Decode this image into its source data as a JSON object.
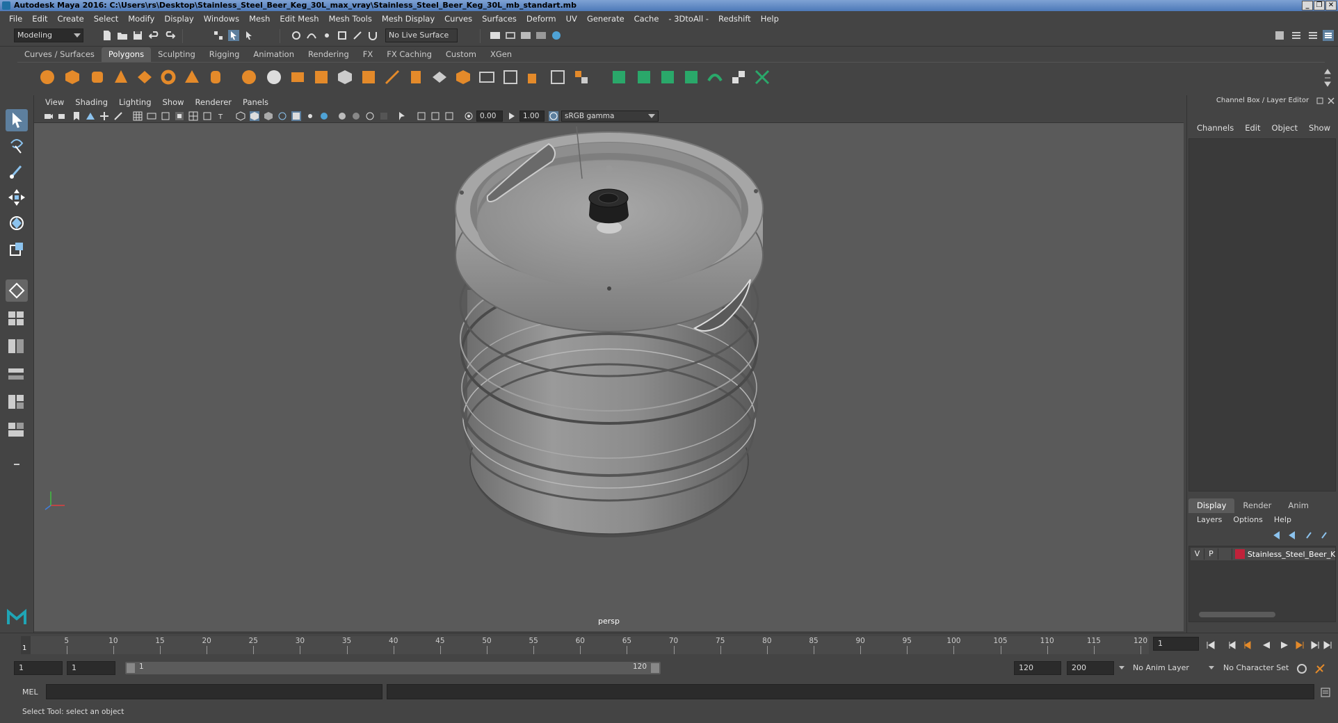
{
  "window": {
    "title": "Autodesk Maya 2016: C:\\Users\\rs\\Desktop\\Stainless_Steel_Beer_Keg_30L_max_vray\\Stainless_Steel_Beer_Keg_30L_mb_standart.mb"
  },
  "menubar": [
    "File",
    "Edit",
    "Create",
    "Select",
    "Modify",
    "Display",
    "Windows",
    "Mesh",
    "Edit Mesh",
    "Mesh Tools",
    "Mesh Display",
    "Curves",
    "Surfaces",
    "Deform",
    "UV",
    "Generate",
    "Cache",
    "- 3DtoAll -",
    "Redshift",
    "Help"
  ],
  "statusline": {
    "mode": "Modeling",
    "live_surface": "No Live Surface"
  },
  "shelf": {
    "tabs": [
      "Curves / Surfaces",
      "Polygons",
      "Sculpting",
      "Rigging",
      "Animation",
      "Rendering",
      "FX",
      "FX Caching",
      "Custom",
      "XGen"
    ],
    "active_tab": "Polygons"
  },
  "viewport": {
    "menu": [
      "View",
      "Shading",
      "Lighting",
      "Show",
      "Renderer",
      "Panels"
    ],
    "exposure": "0.00",
    "gamma": "1.00",
    "color_space": "sRGB gamma",
    "camera_label": "persp"
  },
  "channelbox": {
    "title": "Channel Box / Layer Editor",
    "menu": [
      "Channels",
      "Edit",
      "Object",
      "Show"
    ],
    "layer_tabs": [
      "Display",
      "Render",
      "Anim"
    ],
    "layer_menu": [
      "Layers",
      "Options",
      "Help"
    ],
    "layer": {
      "v": "V",
      "p": "P",
      "name": "Stainless_Steel_Beer_K",
      "color": "#c0223a"
    }
  },
  "timeline": {
    "ticks": [
      "5",
      "10",
      "15",
      "20",
      "25",
      "30",
      "35",
      "40",
      "45",
      "50",
      "55",
      "60",
      "65",
      "70",
      "75",
      "80",
      "85",
      "90",
      "95",
      "100",
      "105",
      "110",
      "115",
      "120"
    ],
    "current_frame": "1",
    "current_frame_field": "1"
  },
  "range": {
    "start": "1",
    "playback_start": "1",
    "slider_start": "1",
    "slider_end": "120",
    "playback_end": "120",
    "end": "200",
    "anim_layer": "No Anim Layer",
    "character_set": "No Character Set"
  },
  "cmdline": {
    "label": "MEL"
  },
  "helpline": {
    "text": "Select Tool: select an object"
  },
  "colors": {
    "accent": "#5d7f9e",
    "viewport_bg": "#5a5a5a",
    "panel_bg": "#444444"
  }
}
